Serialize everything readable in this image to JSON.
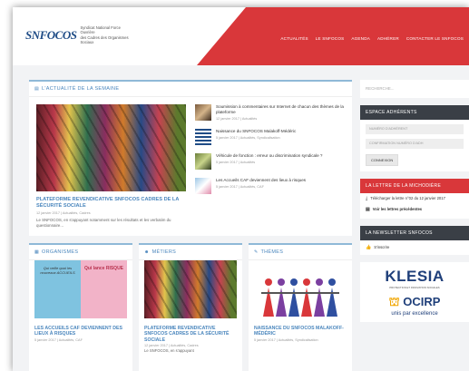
{
  "header": {
    "logo": "SNFOCOS",
    "logo_lines": [
      "Syndicat National Force Ouvrière",
      "des Cadres des Organismes Sociaux"
    ],
    "nav": [
      "ACTUALITÉS",
      "LE SNFOCOS",
      "AGENDA",
      "ADHÉRER",
      "CONTACTER LE SNFOCOS"
    ]
  },
  "news": {
    "title": "L'ACTUALITÉ DE LA SEMAINE",
    "featured": {
      "title": "PLATEFORME REVENDICATIVE SNFOCOS CADRES DE LA SÉCURITÉ SOCIALE",
      "meta": "12 janvier 2017 | Actualités, Cadres",
      "excerpt": "Le SNFOCOS, en s'appuyant notamment sur les résultats et les verbatim du questionnaire..."
    },
    "items": [
      {
        "title": "Soumission à commentaires sur Internet de chacun des thèmes de la plateforme",
        "meta": "12 janvier 2017 | Actualités"
      },
      {
        "title": "Naissance du SNFOCOS Malakoff-Médéric",
        "meta": "5 janvier 2017 | Actualités, Syndicalisation"
      },
      {
        "title": "Véhicule de fonction : erreur ou discrimination syndicale ?",
        "meta": "5 janvier 2017 | Actualités"
      },
      {
        "title": "Les Accueils CAF deviennent des lieux à risques",
        "meta": "5 janvier 2017 | Actualités, CAF"
      }
    ]
  },
  "columns": [
    {
      "header": "ORGANISMES",
      "title": "LES ACCUEILS CAF DEVIENNENT DES LIEUX À RISQUES",
      "meta": "5 janvier 2017 | Actualités, CAF",
      "excerpt": "",
      "img1": "Qui veille quoi les nouveaux ACCUEILS",
      "img2": "Qui lance RISQUE"
    },
    {
      "header": "MÉTIERS",
      "title": "PLATEFORME REVENDICATIVE SNFOCOS CADRES DE LA SÉCURITÉ SOCIALE",
      "meta": "12 janvier 2017 | Actualités, Cadres",
      "excerpt": "Le SNFOCOS, en s'appuyant"
    },
    {
      "header": "THÈMES",
      "title": "NAISSANCE DU SNFOCOS MALAKOFF-MÉDÉRIC",
      "meta": "5 janvier 2017 | Actualités, Syndicalisation",
      "excerpt": ""
    }
  ],
  "sidebar": {
    "search_placeholder": "RECHERCHE...",
    "member_title": "ESPACE ADHÉRENTS",
    "member_number": "NUMÉRO D'ADHÉRENT",
    "member_confirm": "CONFIRMATION NUMÉRO D'ADH",
    "login": "CONNEXION",
    "letter_title": "LA LETTRE DE LA MICHODIÈRE",
    "letter_download": "Télécharger la lettre n°02 du 12 janvier 2017",
    "letter_previous": "Voir les lettres précédentes",
    "newsletter_title": "LA NEWSLETTER SNFOCOS",
    "subscribe": "S'inscrire",
    "klesia": "KLESIA",
    "klesia_sub": "PROTECTION ET INNOVATION SOCIALES",
    "ocirp": "OCIRP",
    "ocirp_sub": "unis par excellence"
  },
  "colors": {
    "brand_red": "#d9373a",
    "accent_blue": "#4a86bd",
    "sidebar_dark": "#3a3f46"
  }
}
